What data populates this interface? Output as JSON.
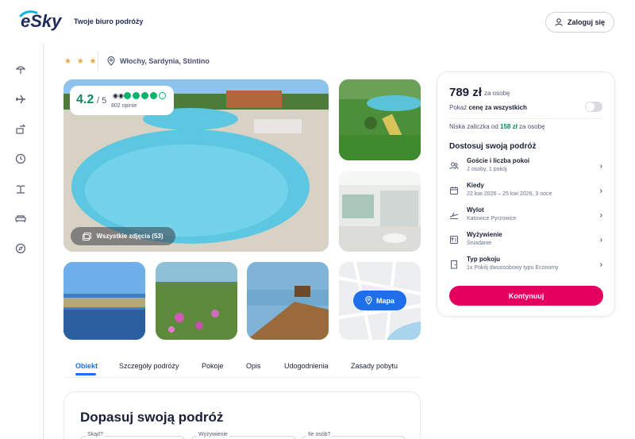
{
  "header": {
    "brand": "eSky",
    "tagline": "Twoje biuro podróży",
    "login_label": "Zaloguj się"
  },
  "sidebar": {
    "items": [
      {
        "icon": "beach-umbrella-icon"
      },
      {
        "icon": "plane-icon"
      },
      {
        "icon": "flight-hotel-icon"
      },
      {
        "icon": "clock-icon"
      },
      {
        "icon": "island-icon"
      },
      {
        "icon": "bed-icon"
      },
      {
        "icon": "compass-icon"
      }
    ]
  },
  "hotel": {
    "stars": "★ ★ ★",
    "location": "Włochy, Sardynia, Stintino",
    "rating": {
      "score": "4.2",
      "scale": "/ 5",
      "reviews": "802 opinie",
      "filled_dots": 4,
      "total_dots": 5
    },
    "all_photos_label": "Wszystkie zdjęcia (53)",
    "map_label": "Mapa"
  },
  "tabs": [
    "Obiekt",
    "Szczegóły podróży",
    "Pokoje",
    "Opis",
    "Udogodnienia",
    "Zasady pobytu"
  ],
  "section2": {
    "title": "Dopasuj swoją podróż",
    "field_labels": [
      "Skąd?",
      "Wyżywienie",
      "Ile osób?"
    ]
  },
  "booking": {
    "price": "789 zł",
    "per_person": "za osobę",
    "show_all_prefix": "Pokaż ",
    "show_all_bold": "cenę za wszystkich",
    "deposit_prefix": "Niska zaliczka od ",
    "deposit_amount": "158 zł",
    "deposit_suffix": " za osobę",
    "adjust_title": "Dostosuj swoją podróż",
    "options": [
      {
        "icon": "guests-icon",
        "title": "Goście i liczba pokoi",
        "sub": "2 osoby, 1 pokój"
      },
      {
        "icon": "calendar-icon",
        "title": "Kiedy",
        "sub": "22 kwi 2026 – 25 kwi 2026, 3 noce"
      },
      {
        "icon": "departure-icon",
        "title": "Wylot",
        "sub": "Katowice Pyrzowice"
      },
      {
        "icon": "meal-icon",
        "title": "Wyżywienie",
        "sub": "Śniadanie"
      },
      {
        "icon": "room-icon",
        "title": "Typ pokoju",
        "sub": "1x Pokój dwuosobowy typu Economy"
      }
    ],
    "cta_label": "Kontynuuj"
  },
  "colors": {
    "accent_blue": "#1f6feb",
    "cta_pink": "#e4005f",
    "green": "#0e8a5f",
    "star": "#f2a33a"
  }
}
